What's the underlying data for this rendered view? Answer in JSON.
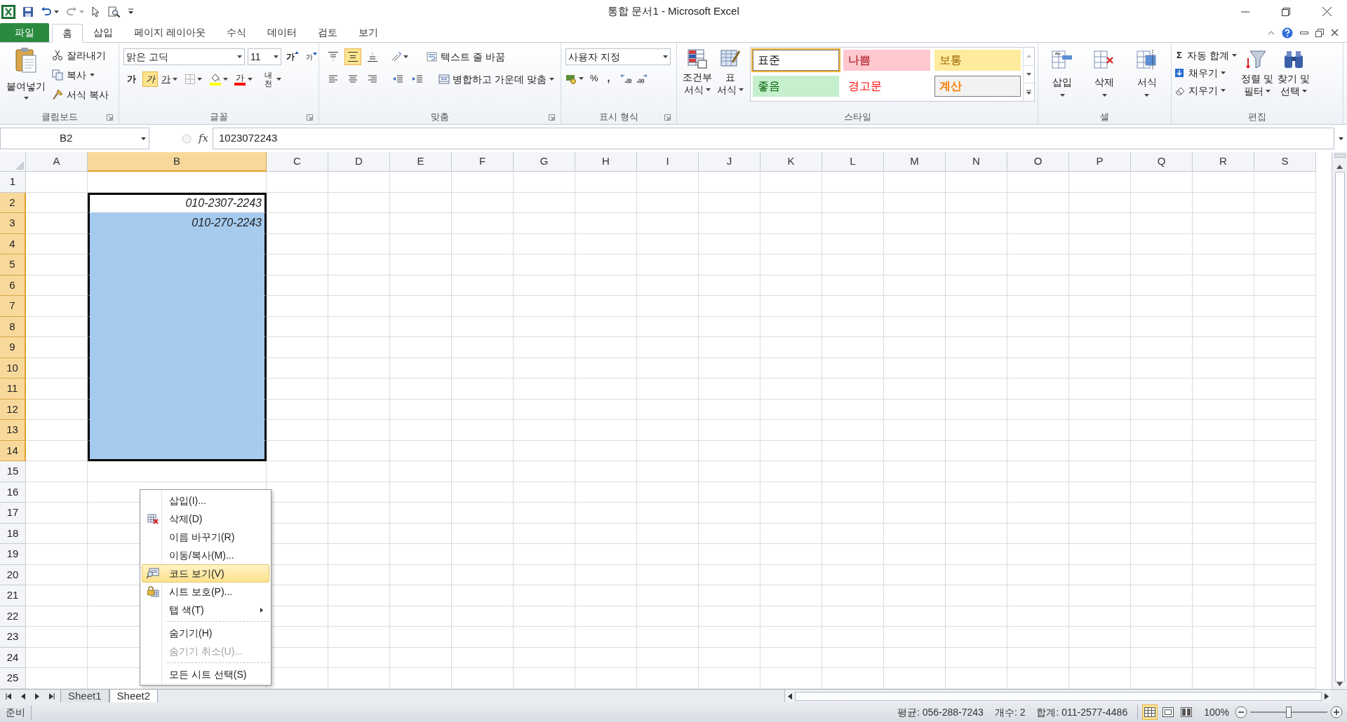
{
  "window": {
    "title": "통합 문서1 - Microsoft Excel"
  },
  "tabs": [
    {
      "label": "파일",
      "kind": "file",
      "selected": false
    },
    {
      "label": "홈",
      "kind": "tab",
      "selected": true
    },
    {
      "label": "삽입",
      "kind": "tab",
      "selected": false
    },
    {
      "label": "페이지 레이아웃",
      "kind": "tab",
      "selected": false
    },
    {
      "label": "수식",
      "kind": "tab",
      "selected": false
    },
    {
      "label": "데이터",
      "kind": "tab",
      "selected": false
    },
    {
      "label": "검토",
      "kind": "tab",
      "selected": false
    },
    {
      "label": "보기",
      "kind": "tab",
      "selected": false
    }
  ],
  "clipboard": {
    "title": "클립보드",
    "paste": "붙여넣기",
    "cut": "잘라내기",
    "copy": "복사",
    "format_painter": "서식 복사"
  },
  "font": {
    "title": "글꼴",
    "font_name": "맑은 고딕",
    "font_size": "11",
    "grow": "가",
    "shrink": "가",
    "bold": "가",
    "italic": "가",
    "italic_on": true,
    "underline": "가",
    "font_color": "가",
    "phonetic": "내천"
  },
  "alignment": {
    "title": "맞춤",
    "middle_on": true,
    "wrap": "텍스트 줄 바꿈",
    "merge": "병합하고 가운데 맞춤"
  },
  "number": {
    "title": "표시 형식",
    "format": "사용자 지정",
    "percent": "%",
    "comma": ","
  },
  "styles": {
    "title": "스타일",
    "conditional": [
      "조건부",
      "서식"
    ],
    "table": [
      "표",
      "서식"
    ],
    "cells": [
      {
        "label": "표준",
        "kind": "normal",
        "selected": true
      },
      {
        "label": "나쁨",
        "kind": "bad",
        "selected": false
      },
      {
        "label": "보통",
        "kind": "neutral",
        "selected": false
      },
      {
        "label": "좋음",
        "kind": "good",
        "selected": false
      },
      {
        "label": "경고문",
        "kind": "warning",
        "selected": false
      },
      {
        "label": "계산",
        "kind": "calculation",
        "selected": false
      }
    ]
  },
  "cells_group": {
    "title": "셀",
    "buttons": [
      "삽입",
      "삭제",
      "서식"
    ]
  },
  "editing": {
    "title": "편집",
    "autosum_symbol": "Σ",
    "autosum": "자동 합계",
    "fill": "채우기",
    "clear": "지우기",
    "sort": [
      "정렬 및",
      "필터"
    ],
    "find": [
      "찾기 및",
      "선택"
    ]
  },
  "formula_bar": {
    "name_box": "B2",
    "fx": "fx",
    "formula": "1023072243"
  },
  "columns": [
    {
      "label": "A",
      "selected": false
    },
    {
      "label": "B",
      "selected": true
    },
    {
      "label": "C",
      "selected": false
    },
    {
      "label": "D",
      "selected": false
    },
    {
      "label": "E",
      "selected": false
    },
    {
      "label": "F",
      "selected": false
    },
    {
      "label": "G",
      "selected": false
    },
    {
      "label": "H",
      "selected": false
    },
    {
      "label": "I",
      "selected": false
    },
    {
      "label": "J",
      "selected": false
    },
    {
      "label": "K",
      "selected": false
    },
    {
      "label": "L",
      "selected": false
    },
    {
      "label": "M",
      "selected": false
    },
    {
      "label": "N",
      "selected": false
    },
    {
      "label": "O",
      "selected": false
    },
    {
      "label": "P",
      "selected": false
    },
    {
      "label": "Q",
      "selected": false
    },
    {
      "label": "R",
      "selected": false
    },
    {
      "label": "S",
      "selected": false
    }
  ],
  "rows": [
    {
      "label": "1",
      "selected": false,
      "active": false
    },
    {
      "label": "2",
      "selected": true,
      "active": true,
      "b": "010-2307-2243"
    },
    {
      "label": "3",
      "selected": true,
      "active": false,
      "b": "010-270-2243"
    },
    {
      "label": "4",
      "selected": true,
      "active": false
    },
    {
      "label": "5",
      "selected": true,
      "active": false
    },
    {
      "label": "6",
      "selected": true,
      "active": false
    },
    {
      "label": "7",
      "selected": true,
      "active": false
    },
    {
      "label": "8",
      "selected": true,
      "active": false
    },
    {
      "label": "9",
      "selected": true,
      "active": false
    },
    {
      "label": "10",
      "selected": true,
      "active": false
    },
    {
      "label": "11",
      "selected": true,
      "active": false
    },
    {
      "label": "12",
      "selected": true,
      "active": false
    },
    {
      "label": "13",
      "selected": true,
      "active": false
    },
    {
      "label": "14",
      "selected": true,
      "active": false
    },
    {
      "label": "15",
      "selected": false,
      "active": false
    },
    {
      "label": "16",
      "selected": false,
      "active": false
    },
    {
      "label": "17",
      "selected": false,
      "active": false
    },
    {
      "label": "18",
      "selected": false,
      "active": false
    },
    {
      "label": "19",
      "selected": false,
      "active": false
    },
    {
      "label": "20",
      "selected": false,
      "active": false
    },
    {
      "label": "21",
      "selected": false,
      "active": false
    },
    {
      "label": "22",
      "selected": false,
      "active": false
    },
    {
      "label": "23",
      "selected": false,
      "active": false
    },
    {
      "label": "24",
      "selected": false,
      "active": false
    },
    {
      "label": "25",
      "selected": false,
      "active": false
    }
  ],
  "sheet_tabs": [
    {
      "label": "Sheet1",
      "selected": false
    },
    {
      "label": "Sheet2",
      "selected": true
    }
  ],
  "context_menu": {
    "items": [
      {
        "kind": "item",
        "label": "삽입(I)...",
        "disabled": false,
        "selected": false
      },
      {
        "kind": "item",
        "label": "삭제(D)",
        "disabled": false,
        "selected": false
      },
      {
        "kind": "item",
        "label": "이름 바꾸기(R)",
        "disabled": false,
        "selected": false
      },
      {
        "kind": "item",
        "label": "이동/복사(M)...",
        "disabled": false,
        "selected": false
      },
      {
        "kind": "item",
        "label": "코드 보기(V)",
        "disabled": false,
        "selected": true
      },
      {
        "kind": "item",
        "label": "시트 보호(P)...",
        "disabled": false,
        "selected": false
      },
      {
        "kind": "submenu",
        "label": "탭 색(T)",
        "disabled": false,
        "selected": false
      },
      {
        "kind": "separator"
      },
      {
        "kind": "item",
        "label": "숨기기(H)",
        "disabled": false,
        "selected": false
      },
      {
        "kind": "item",
        "label": "숨기기 취소(U)...",
        "disabled": true,
        "selected": false
      },
      {
        "kind": "separator"
      },
      {
        "kind": "item",
        "label": "모든 시트 선택(S)",
        "disabled": false,
        "selected": false
      }
    ]
  },
  "status_bar": {
    "mode": "준비",
    "average": "평균: 056-288-7243",
    "count": "개수: 2",
    "sum": "합계: 011-2577-4486",
    "views": [
      {
        "selected": true
      },
      {
        "selected": false
      },
      {
        "selected": false
      }
    ],
    "zoom": "100%",
    "zoom_slider": {
      "level": 0.5
    }
  }
}
